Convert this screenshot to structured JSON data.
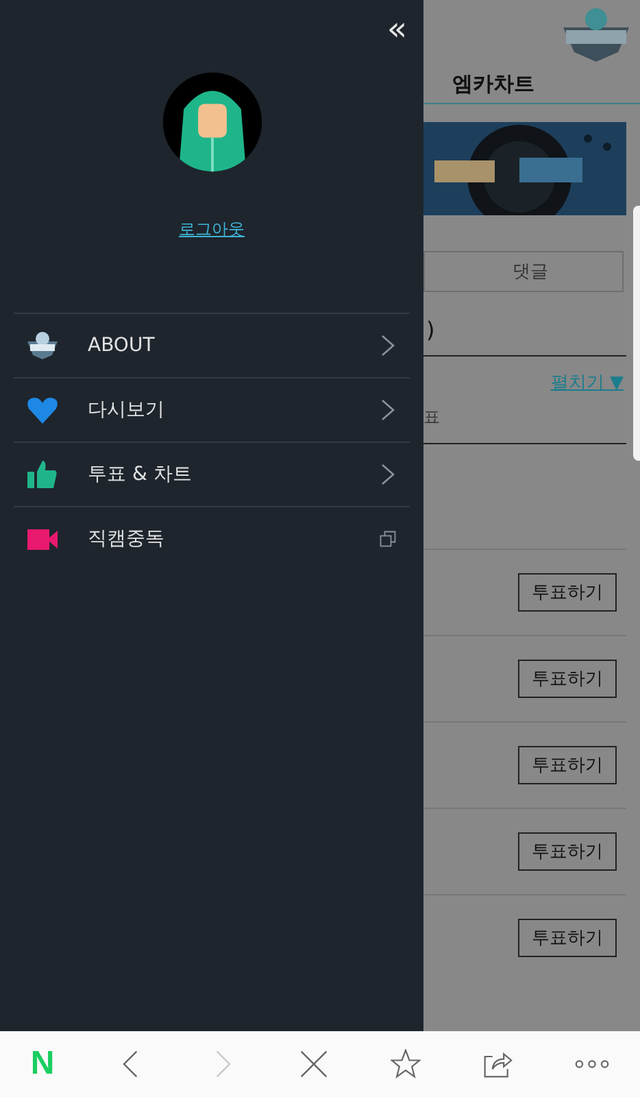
{
  "drawer": {
    "collapse": "«",
    "logout": "로그아웃",
    "menu": [
      {
        "label": "ABOUT",
        "kind": "submenu"
      },
      {
        "label": "다시보기",
        "kind": "submenu"
      },
      {
        "label": "투표 & 차트",
        "kind": "submenu"
      },
      {
        "label": "직캠중독",
        "kind": "external"
      }
    ]
  },
  "page": {
    "title": "엠카차트",
    "comment_button": "댓글",
    "fragment": ")",
    "expand_link": "펼치기 ▼",
    "fragment_2": "표",
    "vote_buttons": [
      "투표하기",
      "투표하기",
      "투표하기",
      "투표하기",
      "투표하기"
    ]
  },
  "browser_bar": [
    {
      "kind": "logo",
      "label": "N",
      "disabled": false
    },
    {
      "kind": "back",
      "disabled": false
    },
    {
      "kind": "forward",
      "disabled": true
    },
    {
      "kind": "close",
      "disabled": false
    },
    {
      "kind": "star",
      "disabled": false
    },
    {
      "kind": "share",
      "disabled": false
    },
    {
      "kind": "more",
      "disabled": false
    }
  ]
}
